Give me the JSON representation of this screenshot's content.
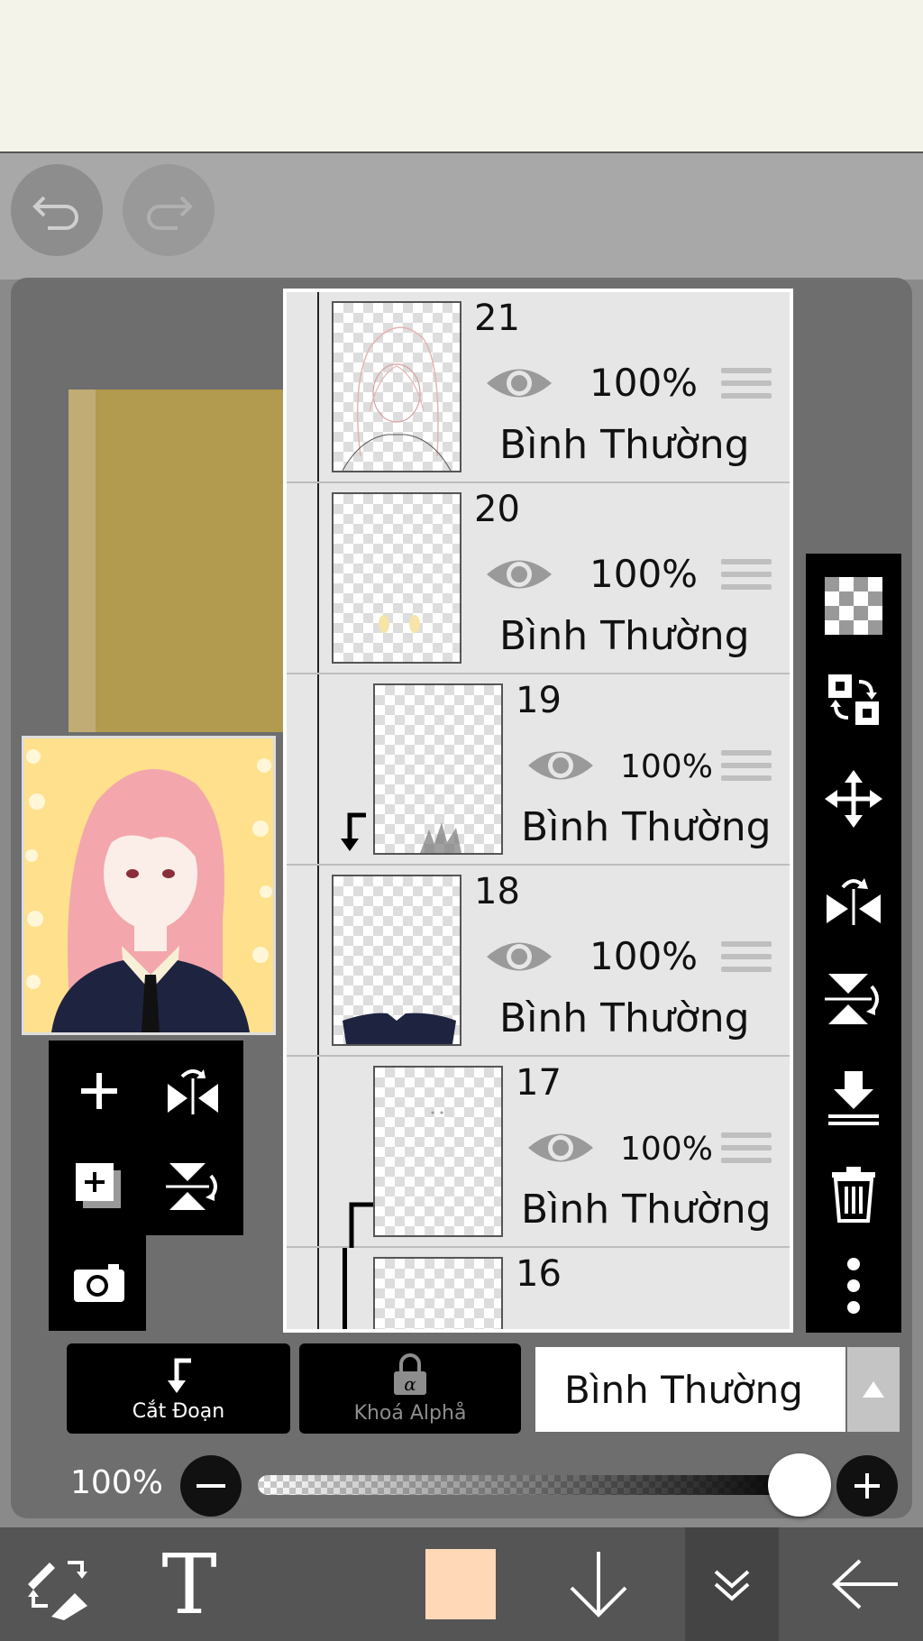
{
  "top_controls": {
    "undo_icon": "undo-icon",
    "redo_icon": "redo-icon"
  },
  "layers": [
    {
      "number": "21",
      "opacity": "100%",
      "blend": "Bình Thường",
      "clipped": false
    },
    {
      "number": "20",
      "opacity": "100%",
      "blend": "Bình Thường",
      "clipped": false
    },
    {
      "number": "19",
      "opacity": "100%",
      "blend": "Bình Thường",
      "clipped": true
    },
    {
      "number": "18",
      "opacity": "100%",
      "blend": "Bình Thường",
      "clipped": false
    },
    {
      "number": "17",
      "opacity": "100%",
      "blend": "Bình Thường",
      "clipped": true
    },
    {
      "number": "16",
      "opacity": "",
      "blend": "",
      "clipped": true
    }
  ],
  "bottom_controls": {
    "clip_label": "Cắt Đoạn",
    "alpha_lock_label": "Khoá Alphå",
    "blend_mode": "Bình Thường"
  },
  "opacity_control": {
    "label": "100%",
    "value_percent": 100
  },
  "colors": {
    "current_color": "#ffd8b8",
    "accent_black": "#000000"
  }
}
